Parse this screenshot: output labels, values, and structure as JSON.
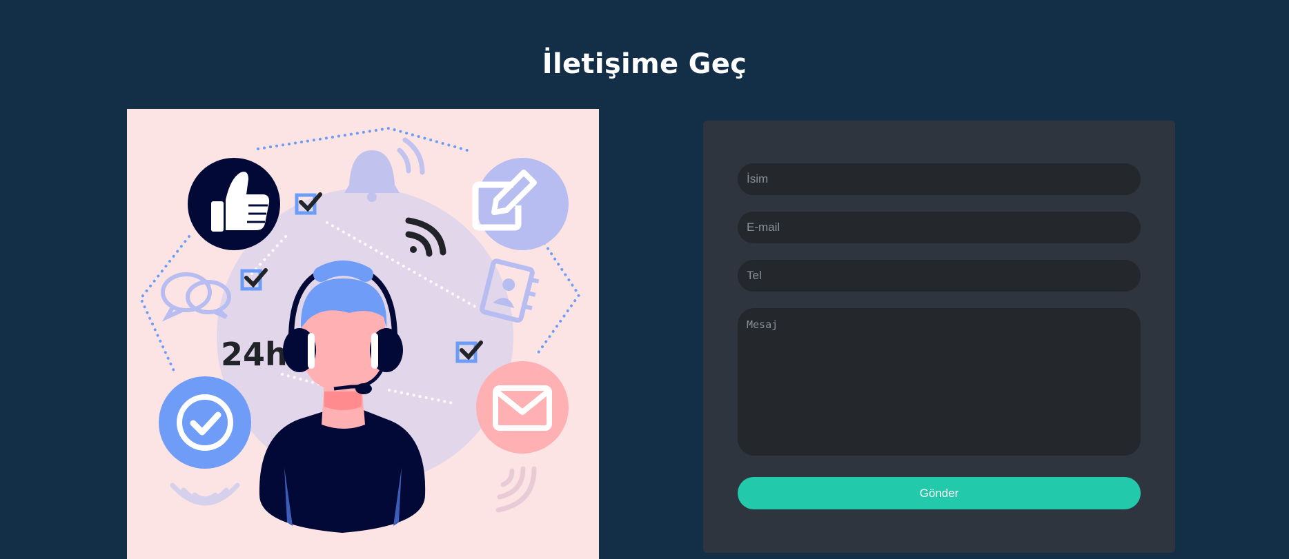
{
  "page": {
    "title": "İletişime Geç"
  },
  "illustration": {
    "text_24h": "24h",
    "icons": [
      "thumbs-up-icon",
      "checkmark-circle-icon",
      "edit-icon",
      "envelope-icon",
      "bell-icon",
      "wifi-icon",
      "chat-bubbles-icon",
      "contact-book-icon",
      "checkbox-icon",
      "headset-agent"
    ]
  },
  "form": {
    "name_placeholder": "İsim",
    "email_placeholder": "E-mail",
    "phone_placeholder": "Tel",
    "message_placeholder": "Mesaj",
    "submit_label": "Gönder"
  },
  "colors": {
    "background": "#132e47",
    "card": "#2f353e",
    "field": "#24282c",
    "accent": "#22c9aa",
    "illustration_bg": "#fde4e4"
  }
}
